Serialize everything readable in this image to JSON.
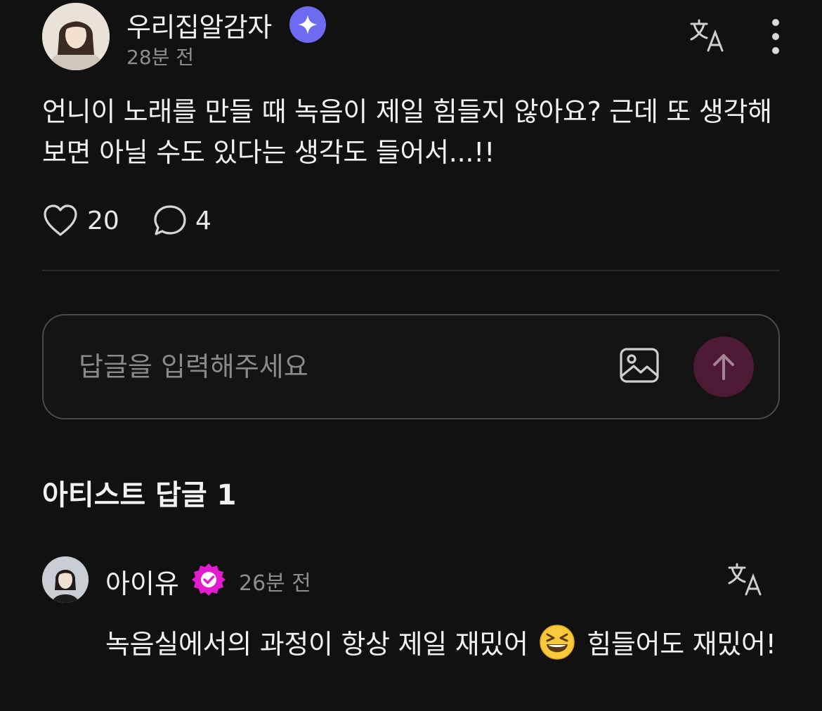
{
  "post": {
    "author": "우리집알감자",
    "time": "28분 전",
    "body": "언니이 노래를 만들 때 녹음이 제일 힘들지 않아요? 근데 또 생각해보면 아닐 수도 있다는 생각도 들어서...!!",
    "likes": "20",
    "comments": "4",
    "icons": {
      "badge": "sparkle-badge-icon",
      "translate": "translate-icon",
      "more": "more-vertical-icon",
      "like": "heart-icon",
      "comment": "comment-bubble-icon"
    }
  },
  "reply_box": {
    "placeholder": "답글을 입력해주세요",
    "icons": {
      "image": "image-icon",
      "send": "arrow-up-icon"
    }
  },
  "artist_section": {
    "title": "아티스트 답글 1"
  },
  "artist_reply": {
    "name": "아이유",
    "time": "26분 전",
    "text_before": "녹음실에서의 과정이 항상 제일 재밌어",
    "text_after": "힘들어도 재밌어!",
    "emoji": "grinning-squinting-face",
    "icons": {
      "verified": "verified-badge-icon",
      "translate": "translate-icon"
    }
  },
  "colors": {
    "background": "#111111",
    "star_badge": "#6f6af2",
    "verified_badge": "#e21ccf",
    "send_button": "#4d1a33",
    "muted_text": "#8e8e8e"
  }
}
